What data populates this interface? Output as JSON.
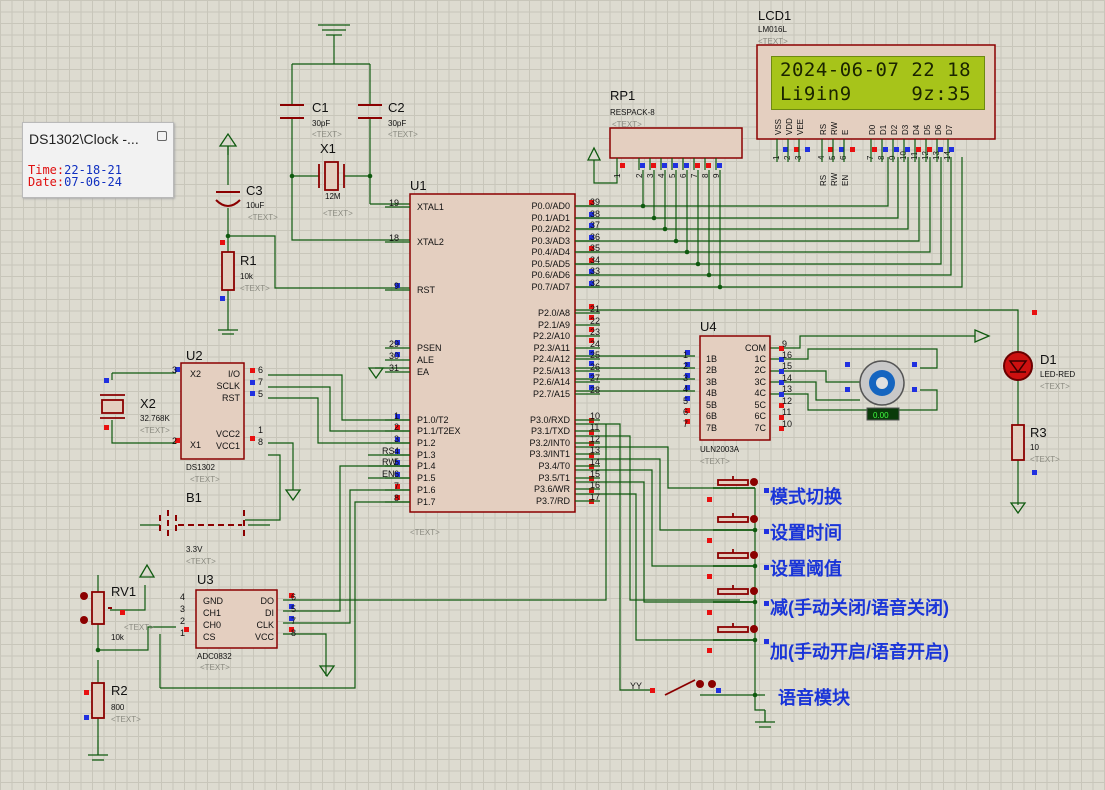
{
  "window_popup": {
    "title": "DS1302\\Clock -...",
    "time_label": "Time:",
    "time_value": "22-18-21",
    "date_label": "Date:",
    "date_value": "07-06-24"
  },
  "lcd": {
    "ref": "LCD1",
    "part": "LM016L",
    "line1": "2024-06-07 22 18",
    "line2": "Li9in9     9z:35",
    "pins": [
      "VSS",
      "VDD",
      "VEE",
      "RS",
      "RW",
      "E",
      "D0",
      "D1",
      "D2",
      "D3",
      "D4",
      "D5",
      "D6",
      "D7"
    ],
    "pin_numbers": [
      "1",
      "2",
      "3",
      "4",
      "5",
      "6",
      "7",
      "8",
      "9",
      "10",
      "11",
      "12",
      "13",
      "14"
    ],
    "net_labels": [
      "RS",
      "RW",
      "EN"
    ]
  },
  "components": {
    "c1": {
      "ref": "C1",
      "value": "30pF"
    },
    "c2": {
      "ref": "C2",
      "value": "30pF"
    },
    "x1": {
      "ref": "X1",
      "value": "12M"
    },
    "c3": {
      "ref": "C3",
      "value": "10uF"
    },
    "r1": {
      "ref": "R1",
      "value": "10k"
    },
    "rp1": {
      "ref": "RP1",
      "value": "RESPACK-8"
    },
    "u1": {
      "ref": "U1"
    },
    "u2": {
      "ref": "U2",
      "part": "DS1302"
    },
    "x2": {
      "ref": "X2",
      "value": "32.768K"
    },
    "b1": {
      "ref": "B1",
      "value": "3.3V"
    },
    "u3": {
      "ref": "U3",
      "part": "ADC0832"
    },
    "rv1": {
      "ref": "RV1",
      "value": "10k"
    },
    "r2": {
      "ref": "R2",
      "value": "800"
    },
    "u4": {
      "ref": "U4",
      "part": "ULN2003A"
    },
    "d1": {
      "ref": "D1",
      "part": "LED-RED"
    },
    "r3": {
      "ref": "R3",
      "value": "10"
    },
    "motor_readout": "0.00",
    "yy": "YY",
    "text_tag": "<TEXT>"
  },
  "u1_left_pins": [
    {
      "num": "19",
      "name": "XTAL1"
    },
    {
      "num": "18",
      "name": "XTAL2"
    },
    {
      "num": "9",
      "name": "RST"
    },
    {
      "num": "29",
      "name": "PSEN"
    },
    {
      "num": "30",
      "name": "ALE"
    },
    {
      "num": "31",
      "name": "EA"
    },
    {
      "num": "1",
      "name": "P1.0/T2"
    },
    {
      "num": "2",
      "name": "P1.1/T2EX"
    },
    {
      "num": "3",
      "name": "P1.2"
    },
    {
      "num": "4",
      "name": "P1.3"
    },
    {
      "num": "5",
      "name": "P1.4"
    },
    {
      "num": "6",
      "name": "P1.5"
    },
    {
      "num": "7",
      "name": "P1.6"
    },
    {
      "num": "8",
      "name": "P1.7"
    }
  ],
  "u1_left_nets": [
    "RS",
    "RW",
    "EN"
  ],
  "u1_right_pins": [
    {
      "num": "39",
      "name": "P0.0/AD0"
    },
    {
      "num": "38",
      "name": "P0.1/AD1"
    },
    {
      "num": "37",
      "name": "P0.2/AD2"
    },
    {
      "num": "36",
      "name": "P0.3/AD3"
    },
    {
      "num": "35",
      "name": "P0.4/AD4"
    },
    {
      "num": "34",
      "name": "P0.5/AD5"
    },
    {
      "num": "33",
      "name": "P0.6/AD6"
    },
    {
      "num": "32",
      "name": "P0.7/AD7"
    },
    {
      "num": "21",
      "name": "P2.0/A8"
    },
    {
      "num": "22",
      "name": "P2.1/A9"
    },
    {
      "num": "23",
      "name": "P2.2/A10"
    },
    {
      "num": "24",
      "name": "P2.3/A11"
    },
    {
      "num": "25",
      "name": "P2.4/A12"
    },
    {
      "num": "26",
      "name": "P2.5/A13"
    },
    {
      "num": "27",
      "name": "P2.6/A14"
    },
    {
      "num": "28",
      "name": "P2.7/A15"
    },
    {
      "num": "10",
      "name": "P3.0/RXD"
    },
    {
      "num": "11",
      "name": "P3.1/TXD"
    },
    {
      "num": "12",
      "name": "P3.2/INT0"
    },
    {
      "num": "13",
      "name": "P3.3/INT1"
    },
    {
      "num": "14",
      "name": "P3.4/T0"
    },
    {
      "num": "15",
      "name": "P3.5/T1"
    },
    {
      "num": "16",
      "name": "P3.6/WR"
    },
    {
      "num": "17",
      "name": "P3.7/RD"
    }
  ],
  "u2_pins": {
    "left": [
      {
        "num": "3",
        "name": "X2"
      },
      {
        "num": "2",
        "name": "X1"
      }
    ],
    "right": [
      {
        "num": "6",
        "name": "I/O"
      },
      {
        "num": "7",
        "name": "SCLK"
      },
      {
        "num": "5",
        "name": "RST"
      },
      {
        "num": "1",
        "name": "VCC2"
      },
      {
        "num": "8",
        "name": "VCC1"
      }
    ]
  },
  "u3_pins": {
    "left": [
      {
        "num": "4",
        "name": "GND"
      },
      {
        "num": "3",
        "name": "CH1"
      },
      {
        "num": "2",
        "name": "CH0"
      },
      {
        "num": "1",
        "name": "CS"
      }
    ],
    "right": [
      {
        "num": "6",
        "name": "DO"
      },
      {
        "num": "5",
        "name": "DI"
      },
      {
        "num": "7",
        "name": "CLK"
      },
      {
        "num": "8",
        "name": "VCC"
      }
    ]
  },
  "u4_pins": {
    "left": [
      {
        "num": "1",
        "name": "1B"
      },
      {
        "num": "2",
        "name": "2B"
      },
      {
        "num": "3",
        "name": "3B"
      },
      {
        "num": "4",
        "name": "4B"
      },
      {
        "num": "5",
        "name": "5B"
      },
      {
        "num": "6",
        "name": "6B"
      },
      {
        "num": "7",
        "name": "7B"
      }
    ],
    "right": [
      {
        "num": "9",
        "name": "COM"
      },
      {
        "num": "16",
        "name": "1C"
      },
      {
        "num": "15",
        "name": "2C"
      },
      {
        "num": "14",
        "name": "3C"
      },
      {
        "num": "13",
        "name": "4C"
      },
      {
        "num": "12",
        "name": "5C"
      },
      {
        "num": "11",
        "name": "6C"
      },
      {
        "num": "10",
        "name": "7C"
      }
    ]
  },
  "rp1_pins": [
    "1",
    "2",
    "3",
    "4",
    "5",
    "6",
    "7",
    "8",
    "9"
  ],
  "buttons": [
    {
      "label": "模式切换"
    },
    {
      "label": "设置时间"
    },
    {
      "label": "设置阈值"
    },
    {
      "label": "减(手动关闭/语音关闭)"
    },
    {
      "label": "加(手动开启/语音开启)"
    }
  ],
  "voice_switch_label": "语音模块",
  "colors": {
    "background": "#dddbd0",
    "wire": "#0f5a0f",
    "component": "#8b0000",
    "chip_fill": "#e4cfc0",
    "lcd_green": "#a7c41a",
    "label_blue": "#1a35d8",
    "pin_red": "#e81010",
    "pin_blue": "#2030e0"
  }
}
